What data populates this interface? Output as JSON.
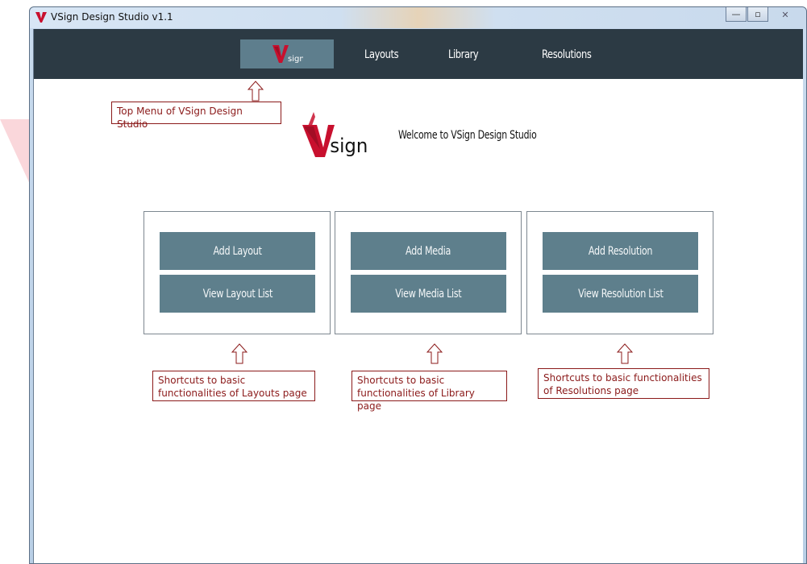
{
  "window": {
    "title": "VSign Design Studio v1.1",
    "controls": {
      "minimize": "—",
      "maximize": "▫",
      "close": "✕"
    }
  },
  "topnav": {
    "logo_text": "sign",
    "items": [
      {
        "label": "Layouts"
      },
      {
        "label": "Library"
      },
      {
        "label": "Resolutions"
      }
    ]
  },
  "welcome": {
    "logo_text": "sign",
    "text": "Welcome to VSign Design Studio"
  },
  "panels": [
    {
      "buttons": [
        {
          "label": "Add Layout"
        },
        {
          "label": "View Layout List"
        }
      ]
    },
    {
      "buttons": [
        {
          "label": "Add Media"
        },
        {
          "label": "View Media List"
        }
      ]
    },
    {
      "buttons": [
        {
          "label": "Add Resolution"
        },
        {
          "label": "View Resolution List"
        }
      ]
    }
  ],
  "annotations": {
    "top_menu": "Top Menu of VSign Design Studio",
    "layouts_line1": "Shortcuts to basic",
    "layouts_line2": "functionalities of Layouts page",
    "library_line1": "Shortcuts to basic",
    "library_line2": "functionalities of Library page",
    "resolutions_line1": "Shortcuts to basic functionalities",
    "resolutions_line2": "of Resolutions page"
  },
  "colors": {
    "nav_bg": "#2c3a44",
    "button_bg": "#5e7f8c",
    "annotation_red": "#8b1a1a",
    "brand_red": "#c8102e"
  }
}
